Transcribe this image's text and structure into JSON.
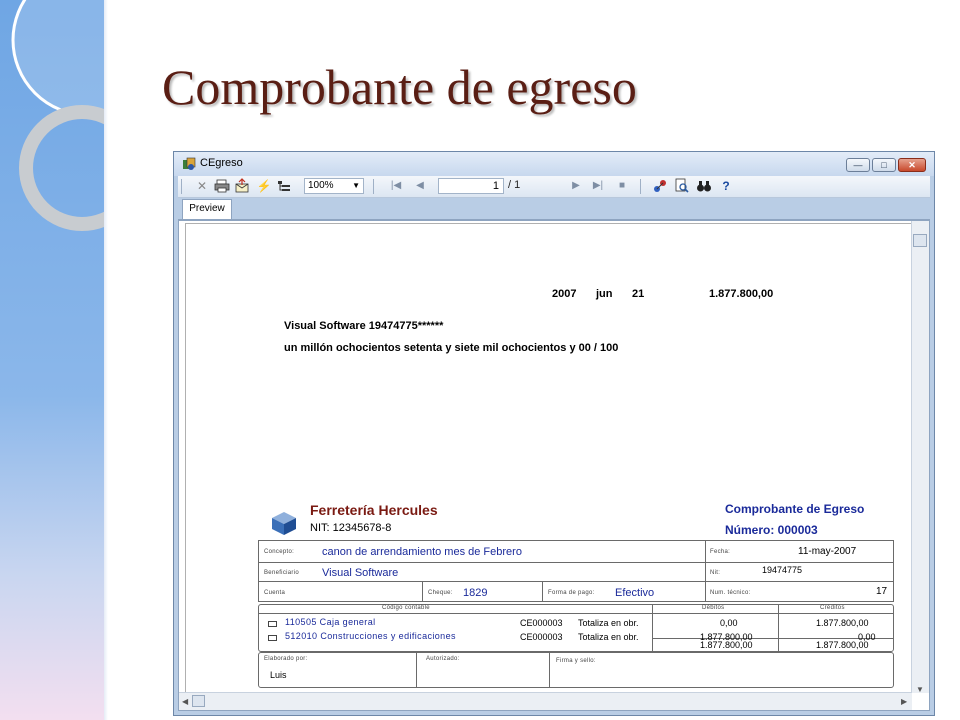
{
  "slide": {
    "title": "Comprobante de egreso"
  },
  "window": {
    "title": "CEgreso",
    "controls": {
      "minimize": "—",
      "maximize": "□",
      "close": "✕"
    }
  },
  "toolbar": {
    "zoom": "100%",
    "page_current": "1",
    "page_total": "/ 1",
    "icons": [
      "close-icon",
      "print-icon",
      "export-icon",
      "refresh-icon",
      "group-tree-icon",
      "first-page-icon",
      "prev-page-icon",
      "next-page-icon",
      "last-page-icon",
      "stop-icon",
      "connect-icon",
      "search-icon",
      "binoculars-icon",
      "help-icon"
    ]
  },
  "tabs": {
    "preview": "Preview"
  },
  "report": {
    "check": {
      "year": "2007",
      "month": "jun",
      "day": "21",
      "amount": "1.877.800,00",
      "payee": "Visual Software 19474775******",
      "amount_words": "un millón ochocientos setenta y siete mil ochocientos y 00 / 100"
    },
    "company": {
      "name": "Ferretería Hercules",
      "nit": "NIT: 12345678-8"
    },
    "voucher": {
      "title": "Comprobante de Egreso",
      "number": "Número: 000003"
    },
    "header": {
      "concepto_label": "Concepto:",
      "concepto": "canon de arrendamiento mes de Febrero",
      "fecha_label": "Fecha:",
      "fecha": "11-may-2007",
      "beneficiario_label": "Beneficiario",
      "beneficiario": "Visual Software",
      "nit_label": "Nit:",
      "nit": "19474775",
      "cuenta_label": "Cuenta",
      "cheque_label": "Cheque:",
      "cheque": "1829",
      "forma_pago_label": "Forma de pago:",
      "forma_pago": "Efectivo",
      "num_tecnico_label": "Num. técnico:",
      "num_tecnico": "17"
    },
    "table": {
      "col_codigo": "Código contable",
      "col_debitos": "Débitos",
      "col_creditos": "Créditos",
      "rows": [
        {
          "account": "110505 Caja general",
          "doc": "CE000003",
          "type": "Totaliza en obr.",
          "debit": "0,00",
          "credit": "1.877.800,00"
        },
        {
          "account": "512010 Construcciones y edificaciones",
          "doc": "CE000003",
          "type": "Totaliza en obr.",
          "debit": "1.877.800,00",
          "credit": "0,00"
        }
      ],
      "total_debit": "1.877.800,00",
      "total_credit": "1.877.800,00"
    },
    "footer": {
      "elaborado_label": "Elaborado por:",
      "elaborado": "Luis",
      "autorizado_label": "Autorizado:",
      "firma_label": "Firma y sello:"
    }
  }
}
